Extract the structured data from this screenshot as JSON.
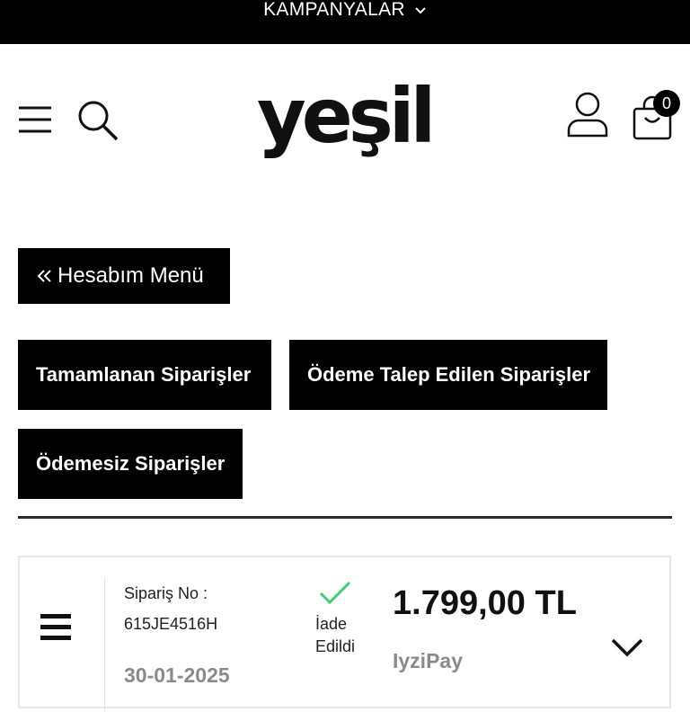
{
  "topbar": {
    "campaigns_label": "KAMPANYALAR"
  },
  "header": {
    "logo_text": "yeşil",
    "cart_count": "0"
  },
  "account": {
    "menu_label": "Hesabım Menü"
  },
  "tabs": [
    {
      "label": "Tamamlanan Siparişler"
    },
    {
      "label": "Ödeme Talep Edilen Siparişler"
    },
    {
      "label": "Ödemesiz Siparişler"
    }
  ],
  "order": {
    "number_label": "Sipariş No :",
    "number": "615JE4516H",
    "date": "30-01-2025",
    "status": "İade Edildi",
    "amount": "1.799,00 TL",
    "payment_method": "IyziPay"
  },
  "colors": {
    "primary": "#000000",
    "status_check": "#3ecf73",
    "muted_text": "#8a8a8a"
  },
  "icons": [
    "chevron-down-icon",
    "hamburger-menu-icon",
    "search-icon",
    "user-icon",
    "shopping-bag-icon",
    "double-chevron-left-icon",
    "checkmark-icon"
  ]
}
